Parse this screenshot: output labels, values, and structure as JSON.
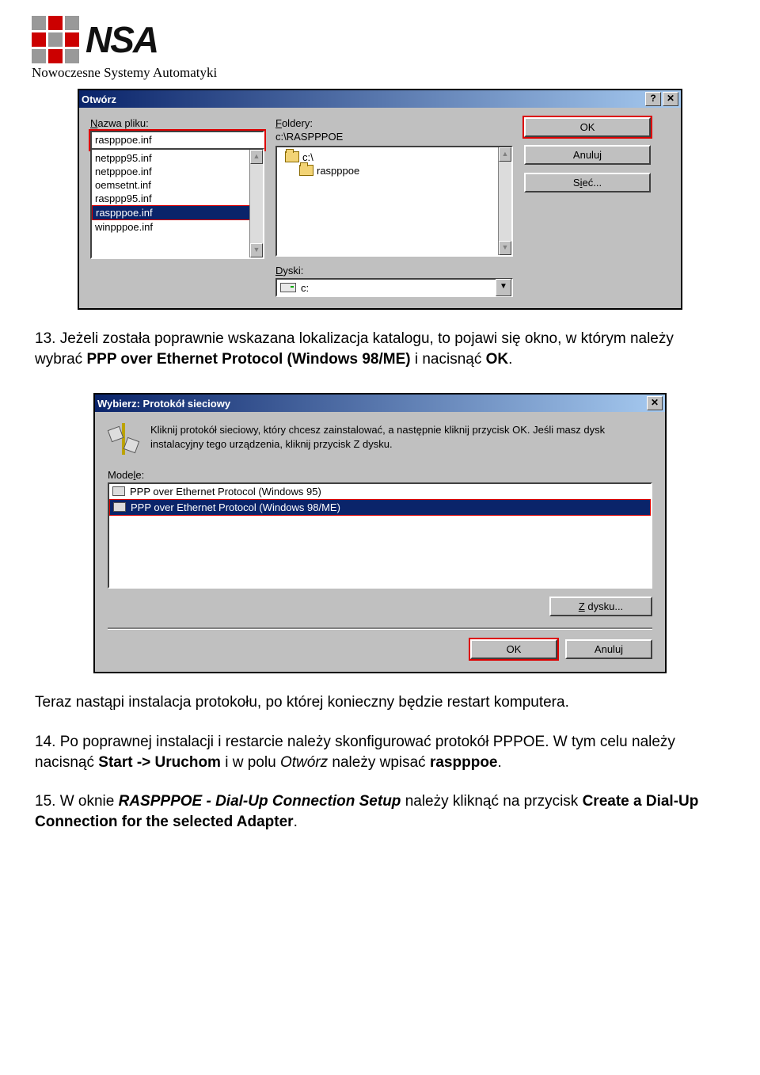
{
  "logo": {
    "text": "NSA",
    "subtitle": "Nowoczesne Systemy Automatyki"
  },
  "dialog1": {
    "title": "Otwórz",
    "help_glyph": "?",
    "close_glyph": "✕",
    "filename_label": "Nazwa pliku:",
    "filename_value": "raspppoe.inf",
    "file_list": [
      "netppp95.inf",
      "netpppoe.inf",
      "oemsetnt.inf",
      "rasppp95.inf",
      "raspppoe.inf",
      "winpppoe.inf"
    ],
    "file_selected_index": 4,
    "folders_label": "Foldery:",
    "folders_path": "c:\\RASPPPOE",
    "folder_tree": [
      "c:\\",
      "raspppoe"
    ],
    "drives_label": "Dyski:",
    "drives_value": "c:",
    "buttons": {
      "ok": "OK",
      "cancel": "Anuluj",
      "network": "Sieć..."
    }
  },
  "para1_pre": "13. Jeżeli została poprawnie wskazana lokalizacja katalogu, to pojawi się okno, w którym należy wybrać ",
  "para1_bold": "PPP over Ethernet Protocol (Windows 98/ME)",
  "para1_post": " i nacisnąć ",
  "para1_bold2": "OK",
  "para1_end": ".",
  "dialog2": {
    "title": "Wybierz: Protokół sieciowy",
    "close_glyph": "✕",
    "instruction": "Kliknij protokół sieciowy, który chcesz zainstalować, a następnie kliknij przycisk OK. Jeśli masz dysk instalacyjny tego urządzenia, kliknij przycisk Z dysku.",
    "models_label": "Modele:",
    "models": [
      "PPP over Ethernet Protocol (Windows 95)",
      "PPP over Ethernet Protocol (Windows 98/ME)"
    ],
    "models_selected_index": 1,
    "from_disk": "Z dysku...",
    "ok": "OK",
    "cancel": "Anuluj"
  },
  "para2": "Teraz nastąpi instalacja protokołu, po której konieczny będzie restart komputera.",
  "para3_pre": "14. Po poprawnej instalacji i restarcie należy skonfigurować protokół PPPOE. W tym celu należy nacisnąć ",
  "para3_b1": "Start -> Uruchom",
  "para3_mid": " i w polu ",
  "para3_i": "Otwórz",
  "para3_mid2": " należy wpisać ",
  "para3_b2": "raspppoe",
  "para3_end": ".",
  "para4_pre": "15. W oknie ",
  "para4_bi": "RASPPPOE - Dial-Up Connection Setup",
  "para4_mid": " należy kliknąć na przycisk ",
  "para4_b": "Create a Dial-Up Connection for the selected Adapter",
  "para4_end": "."
}
